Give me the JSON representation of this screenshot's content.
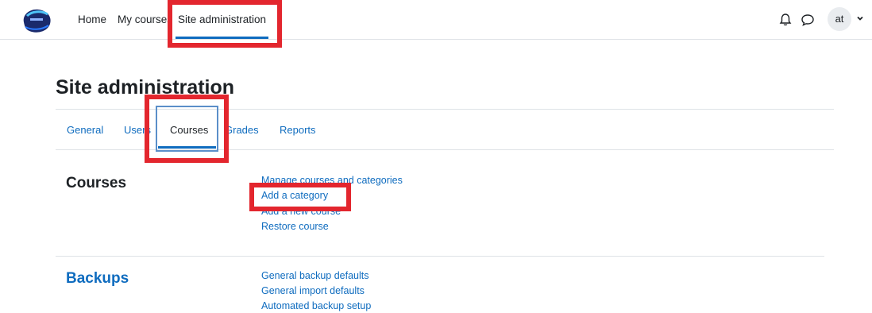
{
  "navbar": {
    "home": "Home",
    "my_courses": "My courses",
    "site_admin": "Site administration",
    "user_initials": "at"
  },
  "page": {
    "title": "Site administration"
  },
  "tabs": [
    {
      "label": "General"
    },
    {
      "label": "Users"
    },
    {
      "label": "Courses",
      "active": true
    },
    {
      "label": "Grades"
    },
    {
      "label": "Reports"
    }
  ],
  "sections": [
    {
      "heading": "Courses",
      "links": [
        "Manage courses and categories",
        "Add a category",
        "Add a new course",
        "Restore course"
      ]
    },
    {
      "heading": "Backups",
      "links": [
        "General backup defaults",
        "General import defaults",
        "Automated backup setup"
      ]
    }
  ],
  "colors": {
    "accent": "#0f6cbf",
    "highlight": "#e3262e",
    "text": "#1d2125"
  },
  "icons": [
    "site-logo",
    "bell-icon",
    "chat-icon",
    "chevron-down-icon"
  ]
}
